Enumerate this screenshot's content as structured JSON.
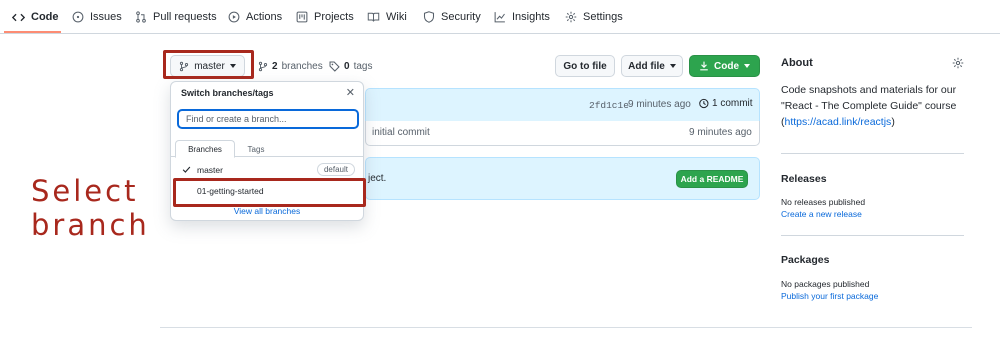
{
  "nav": {
    "tabs": [
      {
        "label": "Code",
        "icon": "code-icon",
        "active": true
      },
      {
        "label": "Issues",
        "icon": "issue-icon"
      },
      {
        "label": "Pull requests",
        "icon": "pull-request-icon"
      },
      {
        "label": "Actions",
        "icon": "play-icon"
      },
      {
        "label": "Projects",
        "icon": "project-icon"
      },
      {
        "label": "Wiki",
        "icon": "book-icon"
      },
      {
        "label": "Security",
        "icon": "shield-icon"
      },
      {
        "label": "Insights",
        "icon": "graph-icon"
      },
      {
        "label": "Settings",
        "icon": "gear-icon"
      }
    ],
    "active_color": "#fd8c73"
  },
  "toolbar": {
    "branch_label": "master",
    "branches_count": "2",
    "branches_label": "branches",
    "tags_count": "0",
    "tags_label": "tags",
    "go_to_file": "Go to file",
    "add_file": "Add file",
    "code": "Code"
  },
  "repo": {
    "commit_hash": "2fd1c1e",
    "commit_time": "9 minutes ago",
    "commit_count": "1 commit",
    "file_message": "initial commit",
    "file_time": "9 minutes ago",
    "readme_text": "ject.",
    "add_readme": "Add a README"
  },
  "dropdown": {
    "title": "Switch branches/tags",
    "placeholder": "Find or create a branch...",
    "tabs": [
      "Branches",
      "Tags"
    ],
    "branches": [
      {
        "name": "master",
        "badge": "default",
        "checked": true
      },
      {
        "name": "01-getting-started"
      }
    ],
    "view_all": "View all branches"
  },
  "about": {
    "title": "About",
    "description": "Code snapshots and materials for our \"React - The Complete Guide\" course",
    "link_prefix": "(",
    "link": "https://acad.link/reactjs",
    "link_suffix": ")"
  },
  "releases": {
    "title": "Releases",
    "empty": "No releases published",
    "create": "Create a new release"
  },
  "packages": {
    "title": "Packages",
    "empty": "No packages published",
    "publish": "Publish your first package"
  },
  "annotation": {
    "line1": "Select",
    "line2": "branch",
    "color": "#a8281d"
  },
  "colors": {
    "green": "#2da44e",
    "link": "#0969da",
    "info_bg": "#ddf4ff"
  }
}
